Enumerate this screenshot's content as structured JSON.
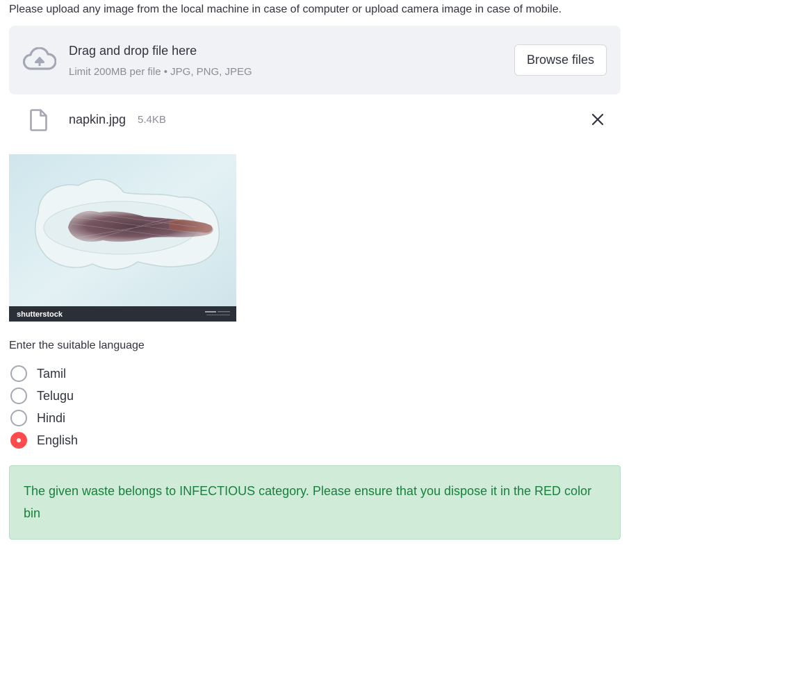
{
  "instruction": "Please upload any image from the local machine in case of computer or upload camera image in case of mobile.",
  "uploader": {
    "title": "Drag and drop file here",
    "limit": "Limit 200MB per file • JPG, PNG, JPEG",
    "browse_label": "Browse files",
    "icon": "cloud-upload-icon"
  },
  "file": {
    "name": "napkin.jpg",
    "size": "5.4KB",
    "icon": "file-icon",
    "remove_icon": "close-icon"
  },
  "preview": {
    "watermark": "shutterstock"
  },
  "language": {
    "label": "Enter the suitable language",
    "options": [
      "Tamil",
      "Telugu",
      "Hindi",
      "English"
    ],
    "selected": "English"
  },
  "result": {
    "message": "The given waste belongs to INFECTIOUS category. Please ensure that you dispose it in the RED color bin"
  },
  "colors": {
    "accent": "#ff4b4b",
    "success_bg": "#d0ecd9",
    "success_text": "#17803d",
    "dropzone_bg": "#f0f2f6"
  }
}
